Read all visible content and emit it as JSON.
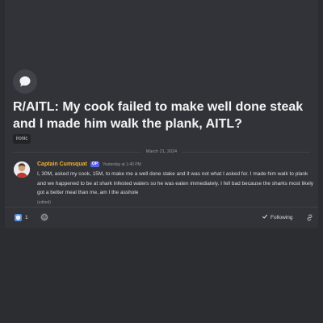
{
  "thread": {
    "title": "R/AITL: My cook failed to make well done steak and I made him walk the plank, AITL?",
    "tag": "ironic",
    "date_divider": "March 21, 2024"
  },
  "message": {
    "author": "Captain Cumsquat",
    "badge": "OP",
    "timestamp": "Yesterday at 1:40 PM",
    "body": "I, 30M, asked my cook, 15M, to make me a well done stake and it was not what I asked for. I made him walk to plank and we happened to be at shark infested waters so he was eaten immediately. I fell bad because the sharks most likely got a better meal than me, am I the asshole",
    "edited": "(edited)"
  },
  "footer": {
    "reaction_count": "1",
    "follow_label": "Following"
  },
  "icons": {
    "thread": "chat-bubble-icon",
    "reaction": "emoji-reaction-icon",
    "add_reaction": "add-reaction-icon",
    "check": "check-icon",
    "link": "link-icon"
  },
  "colors": {
    "background": "#2b2d31",
    "panel": "#313338",
    "author": "#f0b232",
    "badge": "#5865f2"
  }
}
